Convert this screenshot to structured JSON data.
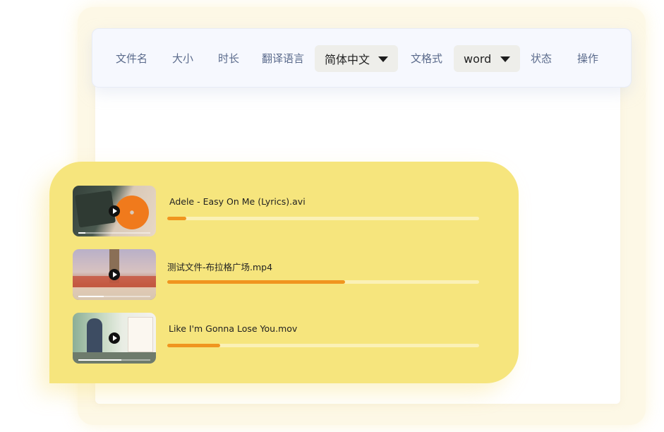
{
  "toolbar": {
    "col_filename": "文件名",
    "col_size": "大小",
    "col_duration": "时长",
    "col_translate_lang": "翻译语言",
    "lang_select_value": "简体中文",
    "col_doc_format": "文格式",
    "format_select_value": "word",
    "col_status": "状态",
    "col_action": "操作"
  },
  "files": [
    {
      "name": "Adele - Easy On Me (Lyrics).avi",
      "progress": 0.06,
      "icon": "play-icon"
    },
    {
      "name": "测试文件-布拉格广场.mp4",
      "progress": 0.57,
      "icon": "play-icon"
    },
    {
      "name": "Like I'm Gonna Lose You.mov",
      "progress": 0.17,
      "icon": "play-icon"
    }
  ],
  "colors": {
    "card": "#f6e57d",
    "progress_fill": "#f0951f",
    "progress_track": "#fbf1b6",
    "toolbar_bg": "#f6f8fe",
    "label_text": "#5b6b8c"
  }
}
